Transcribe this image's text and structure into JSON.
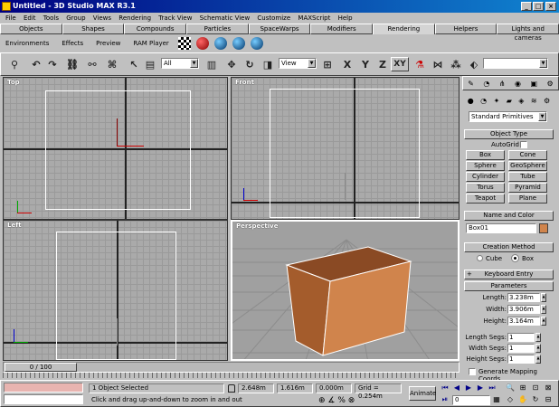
{
  "window": {
    "title": "Untitled - 3D Studio MAX R3.1",
    "min": "_",
    "max": "□",
    "close": "×"
  },
  "menu": [
    "File",
    "Edit",
    "Tools",
    "Group",
    "Views",
    "Rendering",
    "Track View",
    "Schematic View",
    "Customize",
    "MAXScript",
    "Help"
  ],
  "tabs": [
    "Objects",
    "Shapes",
    "Compounds",
    "Particles",
    "SpaceWarps",
    "Modifiers",
    "Rendering",
    "Helpers",
    "Lights and cameras"
  ],
  "active_tab": "Rendering",
  "subtools": {
    "environments": "Environments",
    "effects": "Effects",
    "preview": "Preview",
    "ram_player": "RAM Player"
  },
  "toolbar": {
    "selection_filter": "All",
    "ref_coord": "View",
    "axis_x": "X",
    "axis_y": "Y",
    "axis_z": "Z",
    "axis_xy": "XY"
  },
  "viewports": {
    "top": "Top",
    "front": "Front",
    "left": "Left",
    "perspective": "Perspective"
  },
  "axis": {
    "x": "x",
    "y": "y",
    "z": "z"
  },
  "time_slider": {
    "frame": "0 / 100"
  },
  "command_panel": {
    "category": "Standard Primitives",
    "object_type": {
      "header": "Object Type",
      "autogrid": "AutoGrid",
      "buttons": [
        "Box",
        "Cone",
        "Sphere",
        "GeoSphere",
        "Cylinder",
        "Tube",
        "Torus",
        "Pyramid",
        "Teapot",
        "Plane"
      ]
    },
    "name_color": {
      "header": "Name and Color",
      "name": "Box01",
      "color": "#d0844c"
    },
    "creation_method": {
      "header": "Creation Method",
      "cube": "Cube",
      "box": "Box"
    },
    "keyboard_entry": {
      "header": "Keyboard Entry",
      "expand": "+"
    },
    "parameters": {
      "header": "Parameters",
      "length_label": "Length:",
      "length": "3.238m",
      "width_label": "Width:",
      "width": "3.906m",
      "height_label": "Height:",
      "height": "3.164m",
      "lsegs_label": "Length Segs:",
      "lsegs": "1",
      "wsegs_label": "Width Segs:",
      "wsegs": "1",
      "hsegs_label": "Height Segs:",
      "hsegs": "1",
      "mapping": "Generate Mapping Coords."
    }
  },
  "status": {
    "selected": "1 Object Selected",
    "prompt": "Click and drag up-and-down to zoom in and out",
    "x": "2.648m",
    "y": "1.616m",
    "z": "0.000m",
    "grid": "Grid = 0.254m",
    "animate": "Animate",
    "frame": "0"
  },
  "colors": {
    "box_face": "#d0844c",
    "box_side": "#a45c2c",
    "box_top": "#8a4a24",
    "active_tab": "#d4d4d4"
  }
}
